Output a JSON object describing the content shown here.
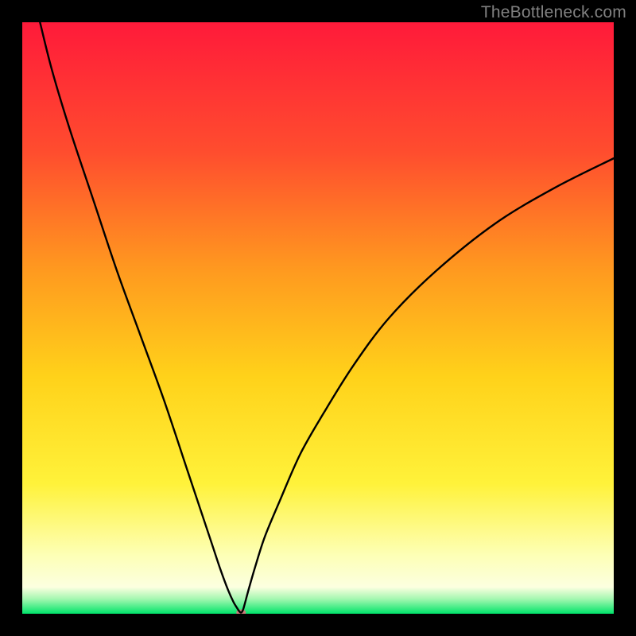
{
  "watermark": "TheBottleneck.com",
  "chart_data": {
    "type": "line",
    "title": "",
    "xlabel": "",
    "ylabel": "",
    "xlim": [
      0,
      100
    ],
    "ylim": [
      0,
      100
    ],
    "grid": false,
    "gradient_stops": [
      {
        "offset": 0,
        "color": "#ff1a3a"
      },
      {
        "offset": 0.22,
        "color": "#ff4d2e"
      },
      {
        "offset": 0.42,
        "color": "#ff9a1f"
      },
      {
        "offset": 0.6,
        "color": "#ffd21a"
      },
      {
        "offset": 0.78,
        "color": "#fff23a"
      },
      {
        "offset": 0.9,
        "color": "#fdffb5"
      },
      {
        "offset": 0.955,
        "color": "#fcffe0"
      },
      {
        "offset": 0.975,
        "color": "#a4f7b0"
      },
      {
        "offset": 1.0,
        "color": "#00e46a"
      }
    ],
    "series": [
      {
        "name": "bottleneck-curve",
        "color": "#000000",
        "x": [
          3,
          5,
          8,
          12,
          16,
          20,
          24,
          28,
          30,
          32,
          33.5,
          34.8,
          35.7,
          36.3,
          36.7,
          37.0,
          37.3,
          37.6,
          38.3,
          39.4,
          41,
          43.5,
          47,
          51,
          56,
          62,
          70,
          80,
          90,
          100
        ],
        "values": [
          100,
          92,
          82,
          70,
          58,
          47,
          36,
          24,
          18,
          12,
          7.5,
          4.0,
          2.0,
          1.0,
          0.4,
          0.2,
          0.6,
          1.6,
          4.2,
          8.0,
          13,
          19,
          27,
          34,
          42,
          50,
          58,
          66,
          72,
          77
        ]
      }
    ],
    "annotations": [
      {
        "name": "minimum-marker",
        "x": 37.0,
        "y": 0.2,
        "color": "#cc7a7a",
        "rx": 6,
        "ry": 4
      }
    ]
  }
}
